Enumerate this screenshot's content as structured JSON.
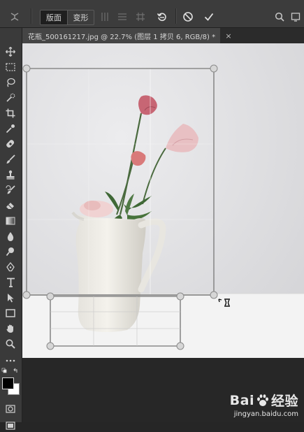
{
  "options_bar": {
    "mode_buttons": [
      "版面",
      "变形"
    ]
  },
  "document_tab": {
    "title": "花瓶_500161217.jpg @ 22.7% (图层 1 拷贝 6, RGB/8) *",
    "close": "×"
  },
  "toolbar": {
    "tools": [
      "move-tool",
      "marquee-tool",
      "lasso-tool",
      "quick-select-tool",
      "crop-tool",
      "eyedropper-tool",
      "healing-brush-tool",
      "brush-tool",
      "clone-stamp-tool",
      "history-brush-tool",
      "eraser-tool",
      "gradient-tool",
      "blur-tool",
      "dodge-tool",
      "pen-tool",
      "type-tool",
      "path-select-tool",
      "rectangle-tool",
      "hand-tool",
      "zoom-tool",
      "more-tools"
    ],
    "foreground_color": "#000000",
    "background_color": "#ffffff"
  },
  "watermark": {
    "brand": "Bai",
    "brand_suffix": "经验",
    "url": "jingyan.baidu.com"
  },
  "colors": {
    "ui_dark": "#3c3c3c",
    "canvas_bg": "#e4e4e6",
    "handle": "#d8d8d8"
  }
}
